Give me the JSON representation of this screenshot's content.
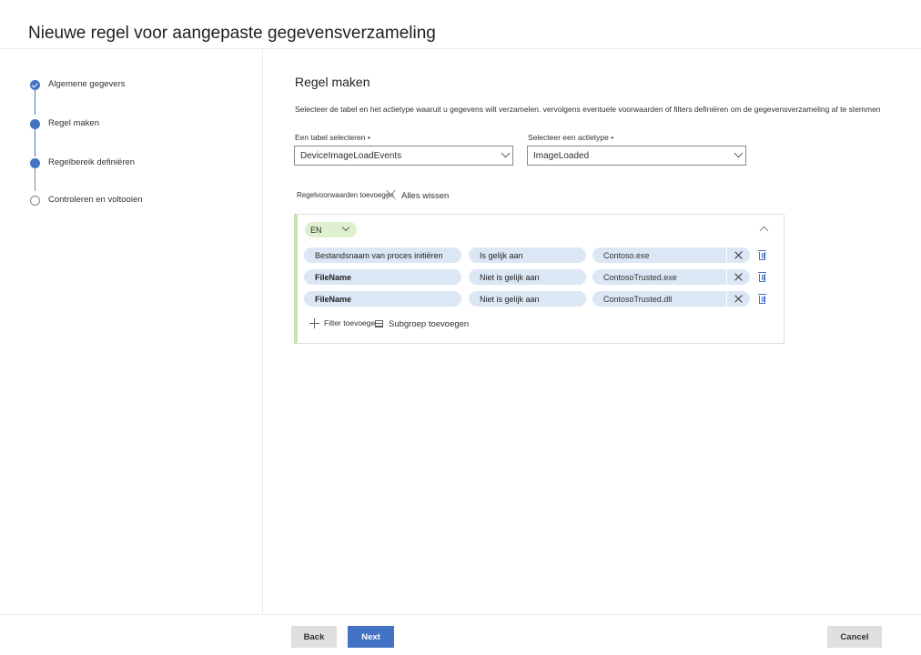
{
  "page": {
    "title": "Nieuwe regel voor aangepaste gegevensverzameling"
  },
  "steps": [
    {
      "label": "Algemene gegevers",
      "state": "done"
    },
    {
      "label": "Regel maken",
      "state": "current"
    },
    {
      "label": "Regelbereik definiëren",
      "state": "current"
    },
    {
      "label": "Controleren en voltooien",
      "state": "todo"
    }
  ],
  "main": {
    "title": "Regel maken",
    "description": "Selecteer de tabel en het actietype waaruit u gegevens wilt verzamelen. vervolgens eventuele voorwaarden of filters definiëren om de gegevensverzameling af te stemmen",
    "table_label": "Een tabel selecteren •",
    "table_value": "DeviceImageLoadEvents",
    "action_label": "Selecteer een actietype •",
    "action_value": "ImageLoaded",
    "add_conditions": "Regelvoorwaarden toevoegen",
    "clear_all": "Alles wissen",
    "operator": "EN",
    "conditions": [
      {
        "field": "Bestandsnaam van proces initiëren",
        "op": "Is gelijk aan",
        "value": "Contoso.exe"
      },
      {
        "field": "FileName",
        "op": "Niet is gelijk aan",
        "value": "ContosoTrusted.exe"
      },
      {
        "field": "FileName",
        "op": "Niet is gelijk aan",
        "value": "ContosoTrusted.dll"
      }
    ],
    "add_filter": "Filter toevoegen",
    "add_subgroup": "Subgroep toevoegen"
  },
  "footer": {
    "back": "Back",
    "next": "Next",
    "cancel": "Cancel"
  },
  "colors": {
    "accent": "#4472c4",
    "pill": "#dbe7f5",
    "group": "#dff0d0"
  }
}
